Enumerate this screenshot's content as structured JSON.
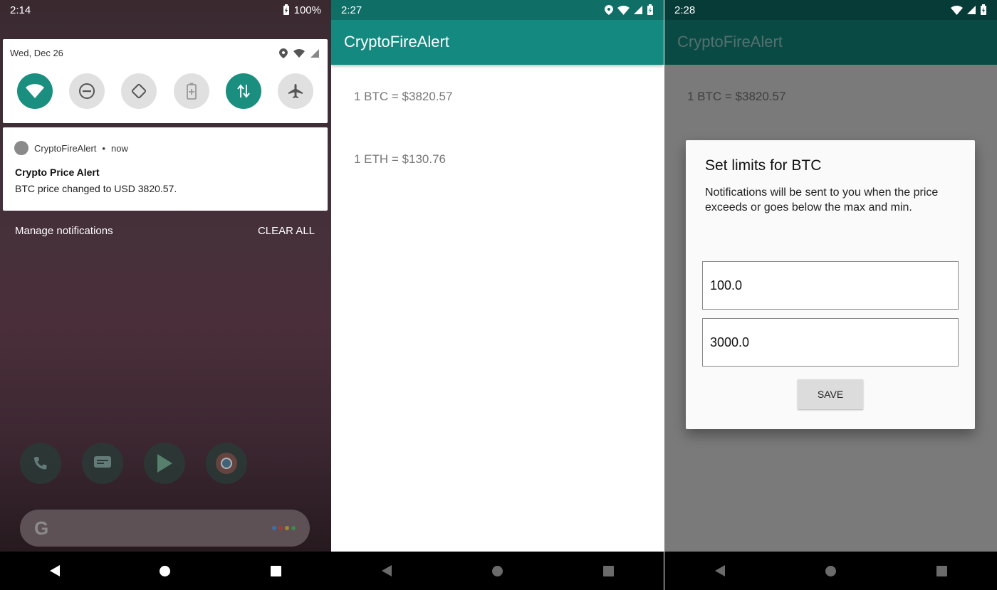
{
  "screen1": {
    "status": {
      "time": "2:14",
      "battery": "100%"
    },
    "quick_settings": {
      "date": "Wed, Dec 26",
      "tiles": [
        {
          "icon": "wifi-icon",
          "on": true
        },
        {
          "icon": "do-not-disturb-icon",
          "on": false
        },
        {
          "icon": "auto-rotate-icon",
          "on": false
        },
        {
          "icon": "battery-saver-icon",
          "on": false
        },
        {
          "icon": "mobile-data-icon",
          "on": true
        },
        {
          "icon": "airplane-mode-icon",
          "on": false
        }
      ]
    },
    "notification": {
      "app": "CryptoFireAlert",
      "time": "now",
      "title": "Crypto Price Alert",
      "body": "BTC price changed to USD 3820.57."
    },
    "actions": {
      "manage": "Manage notifications",
      "clear": "CLEAR ALL"
    }
  },
  "screen2": {
    "status": {
      "time": "2:27"
    },
    "app_title": "CryptoFireAlert",
    "prices": {
      "btc": "1 BTC = $3820.57",
      "eth": "1 ETH = $130.76"
    }
  },
  "screen3": {
    "status": {
      "time": "2:28"
    },
    "app_title": "CryptoFireAlert",
    "prices": {
      "btc": "1 BTC = $3820.57"
    },
    "dialog": {
      "title": "Set limits for BTC",
      "message": "Notifications will be sent to you when the price exceeds or goes below the max and min.",
      "min_value": "100.0",
      "max_value": "3000.0",
      "save_label": "SAVE"
    }
  },
  "colors": {
    "accent": "#14897f",
    "accent_dark": "#0f6e66"
  }
}
